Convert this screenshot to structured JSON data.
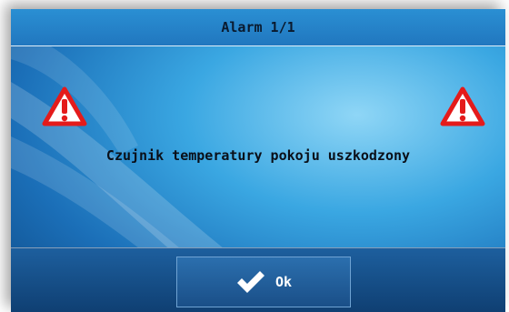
{
  "dialog": {
    "title": "Alarm 1/1",
    "message": "Czujnik temperatury pokoju uszkodzony",
    "icon": "warning-triangle-icon",
    "ok_label": "Ok",
    "ok_icon": "checkmark-icon"
  },
  "colors": {
    "warning_red": "#e41b1b",
    "background_blue": "#2b8fd6",
    "footer_blue": "#154d86"
  }
}
